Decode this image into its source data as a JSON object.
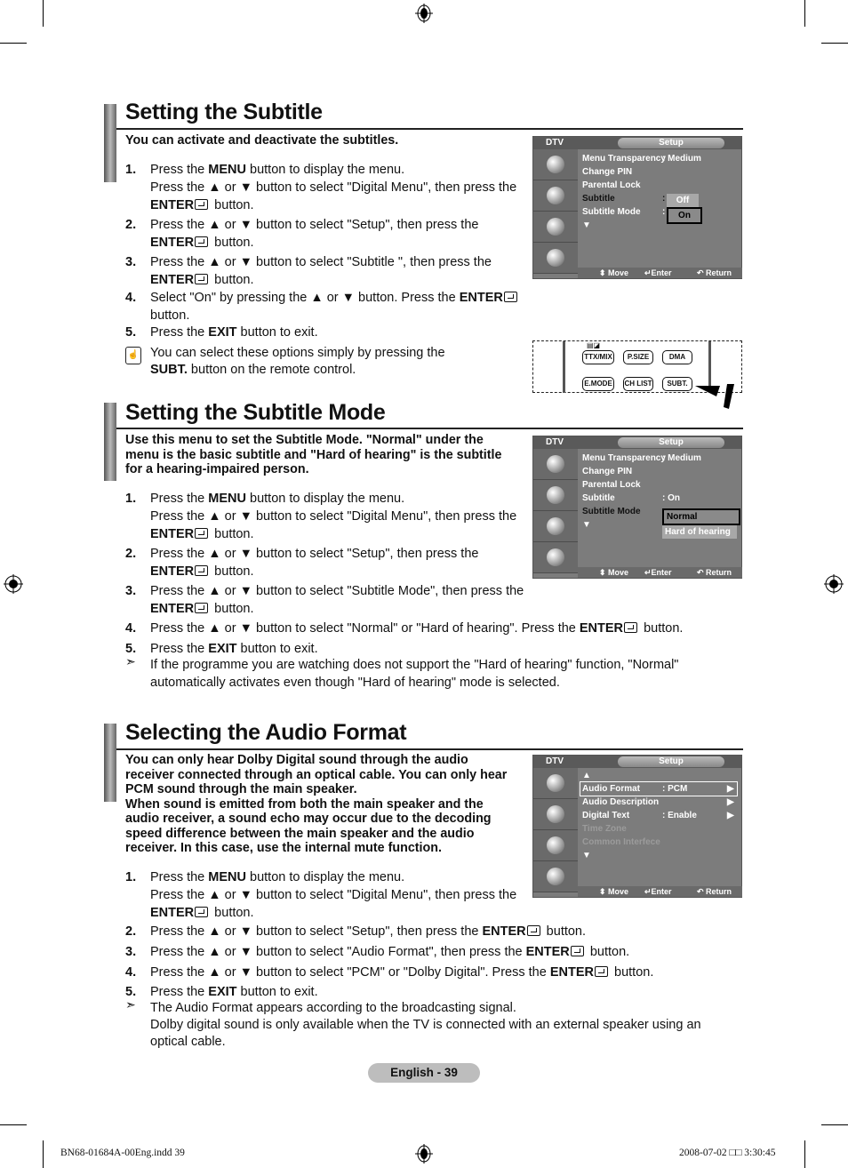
{
  "page": {
    "footer_page": "English - 39",
    "footer_file": "BN68-01684A-00Eng.indd   39",
    "footer_date": "2008-07-02   □□ 3:30:45"
  },
  "sections": [
    {
      "title": "Setting the Subtitle",
      "intro": "You can activate and deactivate the subtitles.",
      "steps": [
        {
          "num": "1.",
          "lines": [
            "Press the {MENU} button to display the menu.",
            "Press the ▲ or ▼ button to select \"Digital Menu\", then press the",
            "{ENTER} button."
          ]
        },
        {
          "num": "2.",
          "lines": [
            "Press the ▲ or ▼ button to select \"Setup\", then press the",
            "{ENTER} button."
          ]
        },
        {
          "num": "3.",
          "lines": [
            "Press the ▲ or ▼ button to select \"Subtitle \", then press the",
            "{ENTER} button."
          ]
        },
        {
          "num": "4.",
          "lines": [
            "Select \"On\" by pressing the ▲ or ▼ button. Press the {ENTER}",
            "button."
          ]
        },
        {
          "num": "5.",
          "lines": [
            "Press the {EXIT} button to exit."
          ]
        }
      ],
      "note_icon": "remote-hand-icon",
      "note": [
        "You can select these options simply by pressing the",
        "{SUBT.} button on the remote control."
      ]
    },
    {
      "title": "Setting the Subtitle Mode",
      "intro": [
        "Use this menu to set the Subtitle Mode. \"Normal\" under the",
        "menu is the basic subtitle and \"Hard of hearing\" is the subtitle",
        "for a hearing-impaired person."
      ],
      "steps": [
        {
          "num": "1.",
          "lines": [
            "Press the {MENU} button to display the menu.",
            "Press the ▲ or ▼ button to select \"Digital Menu\", then press the",
            "{ENTER} button."
          ]
        },
        {
          "num": "2.",
          "lines": [
            "Press the ▲ or ▼ button to select \"Setup\", then press the",
            "{ENTER} button."
          ]
        },
        {
          "num": "3.",
          "lines": [
            "Press the ▲ or ▼ button to select \"Subtitle Mode\", then press the",
            "{ENTER} button."
          ]
        },
        {
          "num": "4.",
          "lines": [
            "Press the ▲ or ▼ button to select \"Normal\" or \"Hard of hearing\". Press the {ENTER} button."
          ]
        },
        {
          "num": "5.",
          "lines": [
            "Press the {EXIT} button to exit."
          ]
        }
      ],
      "note_icon": "arrow-note-icon",
      "note": [
        "If the programme you are watching does not support the \"Hard of hearing\" function, \"Normal\"",
        "automatically activates even though \"Hard of hearing\" mode is selected."
      ]
    },
    {
      "title": "Selecting the Audio Format",
      "intro": [
        "You can only hear Dolby Digital sound through the audio",
        "receiver connected through an optical cable. You can only hear",
        "PCM sound through the main speaker.",
        "When sound is emitted from both the main speaker and the",
        "audio receiver, a sound echo may occur due to the decoding",
        "speed difference between the main speaker and the audio",
        "receiver. In this case, use the internal mute function."
      ],
      "steps": [
        {
          "num": "1.",
          "lines": [
            "Press the {MENU} button to display the menu.",
            "Press the ▲ or ▼ button to select \"Digital Menu\", then press the",
            "{ENTER} button."
          ]
        },
        {
          "num": "2.",
          "lines": [
            "Press the ▲ or ▼ button to select \"Setup\", then press the {ENTER} button."
          ]
        },
        {
          "num": "3.",
          "lines": [
            "Press the ▲ or ▼ button to select \"Audio Format\", then press the {ENTER} button."
          ]
        },
        {
          "num": "4.",
          "lines": [
            "Press the ▲ or ▼ button to select \"PCM\" or \"Dolby Digital\". Press the {ENTER} button."
          ]
        },
        {
          "num": "5.",
          "lines": [
            "Press the {EXIT} button to exit."
          ]
        }
      ],
      "note_icon": "arrow-note-icon",
      "note": [
        "The Audio Format appears according to the broadcasting signal.",
        "Dolby digital sound is only available when the TV is connected with an external speaker using an",
        "optical cable."
      ]
    }
  ],
  "osd": {
    "source": "DTV",
    "menu": "Setup",
    "footer": {
      "move": "Move",
      "enter": "Enter",
      "return": "Return"
    },
    "screens": [
      {
        "rows": [
          {
            "label": "Menu Transparency",
            "value": ": Medium"
          },
          {
            "label": "Change PIN",
            "value": ""
          },
          {
            "label": "Parental Lock",
            "value": ""
          },
          {
            "label": "Subtitle",
            "value": ":",
            "state": "sel"
          },
          {
            "label": "Subtitle Mode",
            "value": ":"
          },
          {
            "label": "▼",
            "value": ""
          }
        ],
        "popup": [
          {
            "label": "Off",
            "style": "hl"
          },
          {
            "label": "On",
            "style": "boxed"
          }
        ]
      },
      {
        "rows": [
          {
            "label": "Menu Transparency",
            "value": ": Medium"
          },
          {
            "label": "Change PIN",
            "value": ""
          },
          {
            "label": "Parental Lock",
            "value": ""
          },
          {
            "label": "Subtitle",
            "value": ": On"
          },
          {
            "label": "Subtitle Mode",
            "value": "",
            "state": "sel"
          },
          {
            "label": "▼",
            "value": ""
          }
        ],
        "popup": [
          {
            "label": "Normal",
            "style": "boxed"
          },
          {
            "label": "Hard of hearing",
            "style": "hl"
          }
        ]
      },
      {
        "rows": [
          {
            "label": "▲",
            "value": ""
          },
          {
            "label": "Audio Format",
            "value": ": PCM",
            "arrow": "▶",
            "state": "boxed"
          },
          {
            "label": "Audio Description",
            "value": "",
            "arrow": "▶"
          },
          {
            "label": "Digital Text",
            "value": ": Enable",
            "arrow": "▶"
          },
          {
            "label": "Time Zone",
            "value": "",
            "state": "dim"
          },
          {
            "label": "Common Interfece",
            "value": "",
            "state": "dim"
          },
          {
            "label": "▼",
            "value": ""
          }
        ]
      }
    ]
  },
  "remote": {
    "buttons": [
      "TTX/MIX",
      "P.SIZE",
      "DMA",
      "E.MODE",
      "CH LIST",
      "SUBT."
    ]
  }
}
